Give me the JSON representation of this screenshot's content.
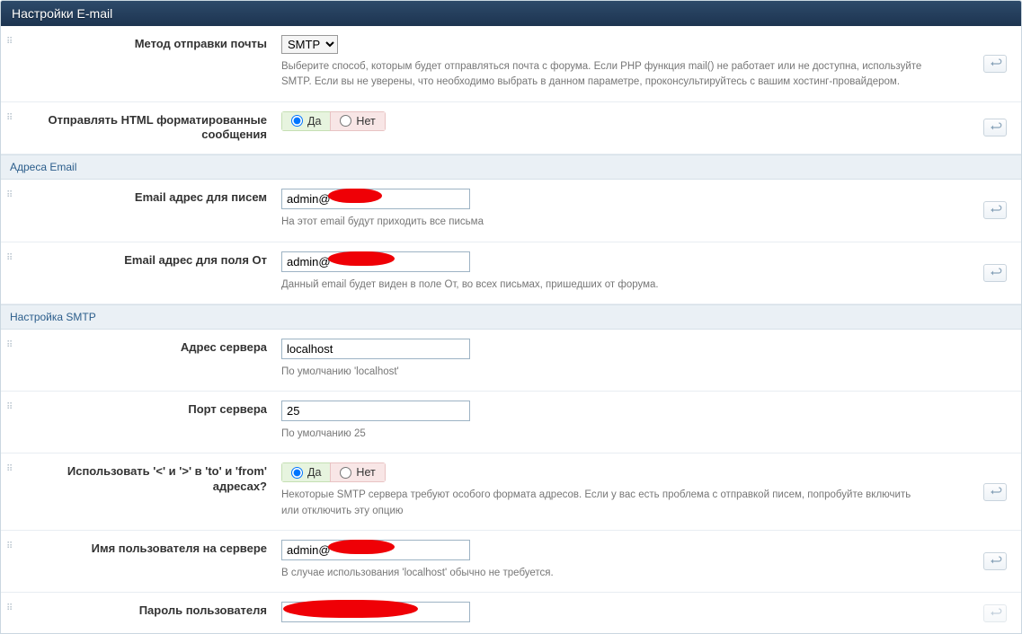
{
  "header": {
    "title": "Настройки E-mail"
  },
  "rows": {
    "method": {
      "label": "Метод отправки почты",
      "value": "SMTP",
      "help": "Выберите способ, которым будет отправляться почта с форума. Если PHP функция mail() не работает или не доступна, используйте SMTP. Если вы не уверены, что необходимо выбрать в данном параметре, проконсультируйтесь с вашим хостинг-провайдером."
    },
    "html": {
      "label": "Отправлять HTML форматированные сообщения",
      "yes": "Да",
      "no": "Нет"
    },
    "addr_sec": {
      "title": "Адреса Email"
    },
    "to": {
      "label": "Email адрес для писем",
      "value": "admin@",
      "help": "На этот email будут приходить все письма"
    },
    "from": {
      "label": "Email адрес для поля От",
      "value": "admin@",
      "help": "Данный email будет виден в поле От, во всех письмах, пришедших от форума."
    },
    "smtp_sec": {
      "title": "Настройка SMTP"
    },
    "host": {
      "label": "Адрес сервера",
      "value": "localhost",
      "help": "По умолчанию 'localhost'"
    },
    "port": {
      "label": "Порт сервера",
      "value": "25",
      "help": "По умолчанию 25"
    },
    "angle": {
      "label": "Использовать '<' и '>' в 'to' и 'from' адресах?",
      "yes": "Да",
      "no": "Нет",
      "help": "Некоторые SMTP сервера требуют особого формата адресов. Если у вас есть проблема с отправкой писем, попробуйте включить или отключить эту опцию"
    },
    "user": {
      "label": "Имя пользователя на сервере",
      "value": "admin@",
      "help": "В случае использования 'localhost' обычно не требуется."
    },
    "pass": {
      "label": "Пароль пользователя"
    }
  }
}
